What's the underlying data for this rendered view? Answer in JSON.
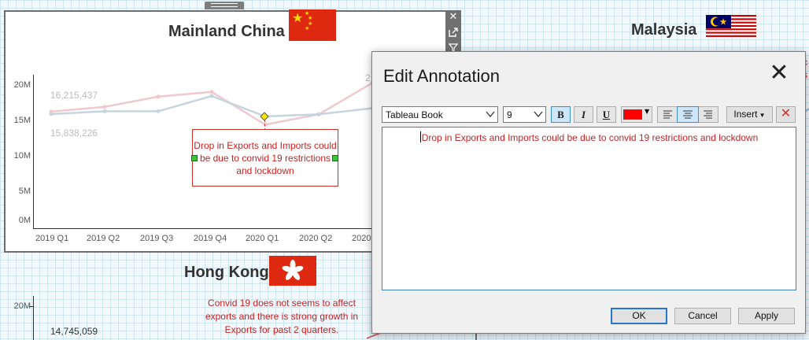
{
  "dashboard": {
    "china": {
      "title": "Mainland China",
      "y_ticks": [
        "20M",
        "15M",
        "10M",
        "5M",
        "0M"
      ],
      "x_ticks": [
        "2019 Q1",
        "2019 Q2",
        "2019 Q3",
        "2019 Q4",
        "2020 Q1",
        "2020 Q2",
        "2020"
      ],
      "label_top": "16,215,437",
      "label_bottom": "15,838,226",
      "label_partial": "2",
      "annotation": "Drop in Exports and Imports could be due to convid 19 restrictions and lockdown",
      "toolbar_icons": [
        "close-icon",
        "popout-icon",
        "filter-icon"
      ]
    },
    "malaysia": {
      "title": "Malaysia"
    },
    "hongkong": {
      "title": "Hong Kong",
      "y_tick": "20M",
      "label": "14,745,059",
      "note": "Convid 19 does not seems to affect exports and there is strong growth in Exports for past 2 quarters."
    },
    "right_edge_fragments": [
      "c",
      "s"
    ]
  },
  "chart_data": {
    "type": "line",
    "title": "Mainland China",
    "categories": [
      "2019 Q1",
      "2019 Q2",
      "2019 Q3",
      "2019 Q4",
      "2020 Q1",
      "2020 Q2",
      "2020 Q3"
    ],
    "series": [
      {
        "values": [
          16215437,
          16900000,
          18400000,
          19100000,
          14300000,
          15800000,
          20400000
        ],
        "color": "#f0c9cf"
      },
      {
        "values": [
          15838226,
          16250000,
          16250000,
          18500000,
          15500000,
          15800000,
          16700000
        ],
        "color": "#c6d4e0"
      }
    ],
    "ylim": [
      0,
      22000000
    ],
    "grid": false
  },
  "dialog": {
    "title": "Edit Annotation",
    "font_name": "Tableau Book",
    "font_size": "9",
    "bold": "B",
    "italic": "I",
    "underline": "U",
    "text_color": "#ff0000",
    "insert_label": "Insert",
    "editor_text": "Drop in Exports and Imports could be due to convid 19 restrictions and lockdown",
    "ok_label": "OK",
    "cancel_label": "Cancel",
    "apply_label": "Apply"
  }
}
